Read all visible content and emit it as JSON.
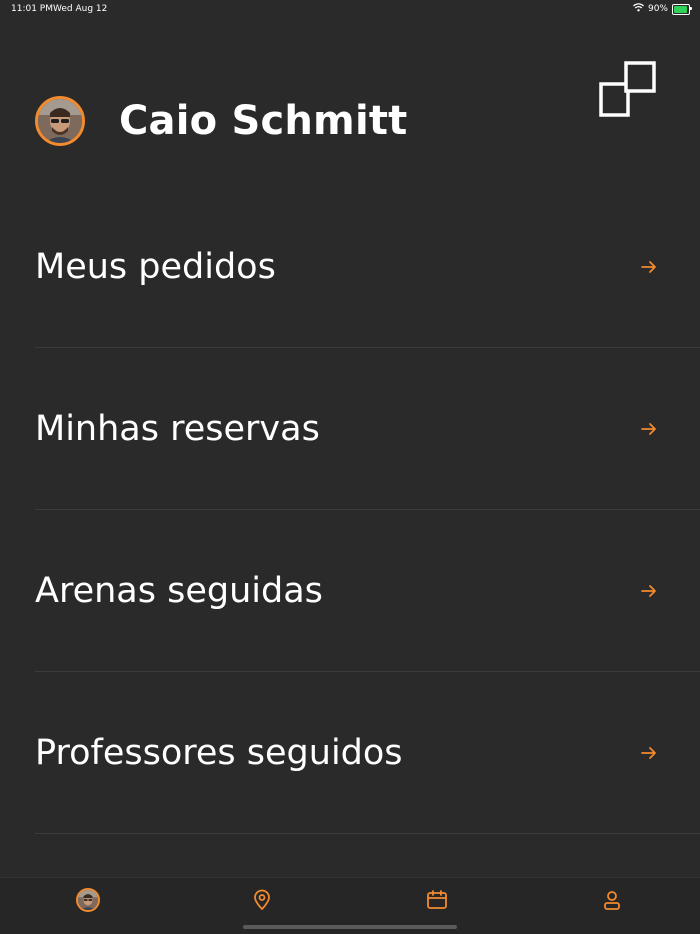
{
  "status_bar": {
    "time": "11:01 PM",
    "date": "Wed Aug 12",
    "battery": "90%",
    "battery_level": 0.9
  },
  "profile": {
    "name": "Caio Schmitt"
  },
  "menu": {
    "items": [
      {
        "label": "Meus pedidos"
      },
      {
        "label": "Minhas reservas"
      },
      {
        "label": "Arenas seguidas"
      },
      {
        "label": "Professores seguidos"
      }
    ]
  },
  "colors": {
    "background": "#2a2a2a",
    "accent": "#f28a2e",
    "text": "#ffffff",
    "divider": "#3c3c3c"
  },
  "tab_bar": {
    "items": [
      {
        "icon": "avatar-icon"
      },
      {
        "icon": "map-pin-icon"
      },
      {
        "icon": "calendar-icon"
      },
      {
        "icon": "user-icon"
      }
    ]
  }
}
